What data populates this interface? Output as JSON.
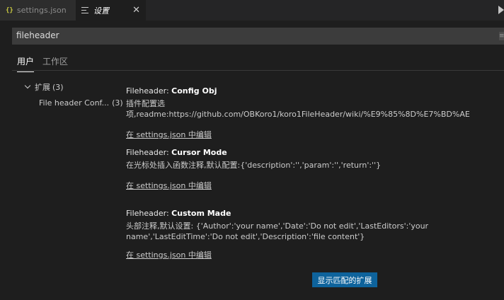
{
  "tabs": [
    {
      "label": "settings.json",
      "icon": "json-braces-icon"
    },
    {
      "label": "设置",
      "icon": "settings-list-icon",
      "close": "✕"
    }
  ],
  "search": {
    "value": "fileheader",
    "clear_label": "≡"
  },
  "scope_tabs": [
    {
      "label": "用户",
      "active": true
    },
    {
      "label": "工作区",
      "active": false
    }
  ],
  "toc": {
    "group": "扩展",
    "group_count": "(3)",
    "child": "File header Conf...",
    "child_count": "(3)"
  },
  "settings": [
    {
      "prefix": "Fileheader: ",
      "name": "Config Obj",
      "description": "插件配置选项,readme:https://github.com/OBKoro1/koro1FileHeader/wiki/%E9%85%8D%E7%BD%AE",
      "edit_link": "在 settings.json 中编辑"
    },
    {
      "prefix": "Fileheader: ",
      "name": "Cursor Mode",
      "description": "在光标处插入函数注释,默认配置:{'description':'','param':'','return':''}",
      "edit_link": "在 settings.json 中编辑"
    },
    {
      "prefix": "Fileheader: ",
      "name": "Custom Made",
      "description": "头部注释,默认设置: {'Author':'your name','Date':'Do not edit','LastEditors':'your name','LastEditTime':'Do not edit','Description':'file content'}",
      "edit_link": "在 settings.json 中编辑"
    }
  ],
  "show_matching_extensions": "显示匹配的扩展",
  "colors": {
    "accent_button": "#0e639c",
    "json_icon": "#cbcb41"
  }
}
